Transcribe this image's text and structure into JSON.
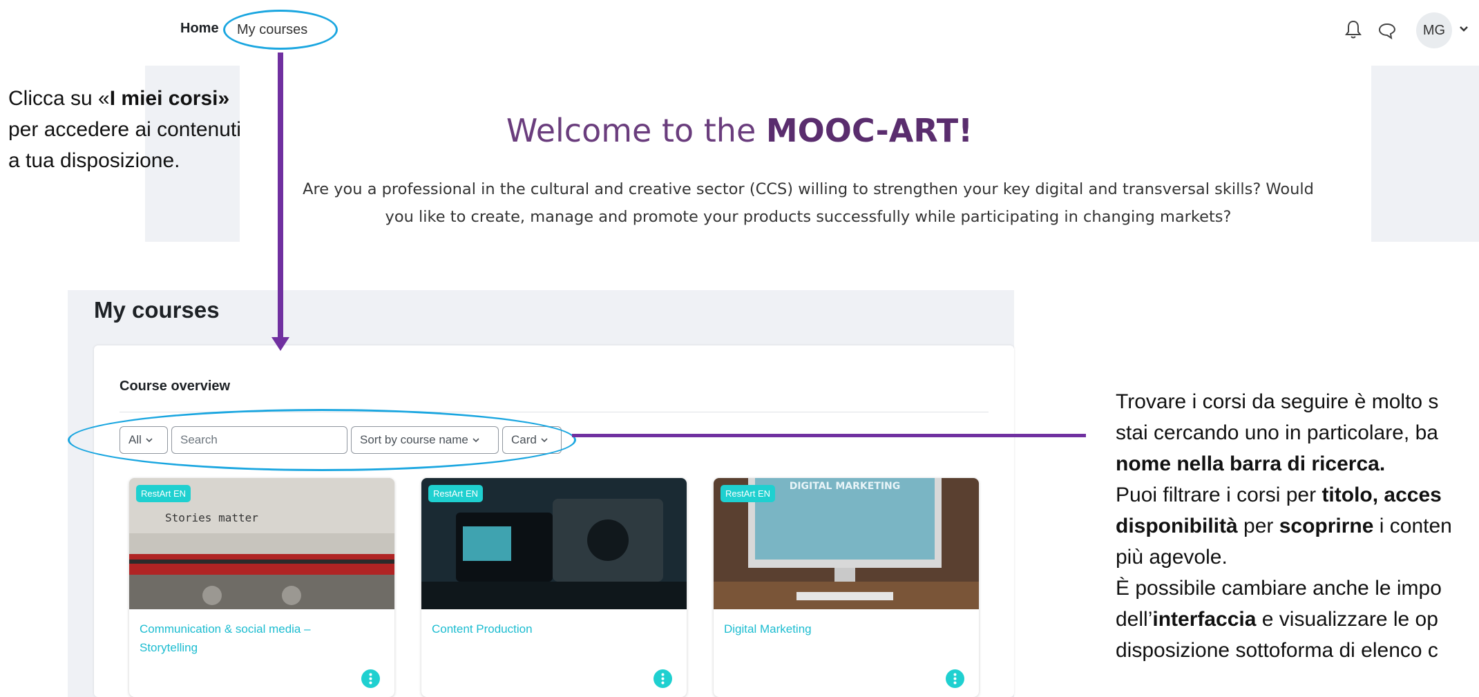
{
  "nav": {
    "home": "Home",
    "my_courses": "My courses",
    "avatar_initials": "MG",
    "icons": [
      "bell-icon",
      "chat-icon",
      "chevron-down-icon"
    ]
  },
  "banner": {
    "welcome_prefix": "Welcome to the ",
    "welcome_brand": "MOOC-ART!",
    "intro_line1": "Are you a professional in the cultural and creative sector (CCS) willing to strengthen your key digital and transversal skills? Would",
    "intro_line2": "you like to create, manage and promote your products successfully while participating in changing markets?"
  },
  "annotation_left": {
    "p1": "Clicca su «",
    "p1_bold": "I miei corsi»",
    "p2": " per accedere ai contenuti a tua disposizione."
  },
  "my_courses": {
    "title": "My courses",
    "overview_title": "Course overview",
    "filter_all": "All",
    "search_placeholder": "Search",
    "sort_label": "Sort by course name",
    "view_label": "Card",
    "courses": [
      {
        "badge": "RestArt EN",
        "name": "Communication & social media – Storytelling",
        "image_text": "Stories matter"
      },
      {
        "badge": "RestArt EN",
        "name": "Content Production",
        "image_text": ""
      },
      {
        "badge": "RestArt EN",
        "name": "Digital Marketing",
        "image_text": "DIGITAL MARKETING"
      }
    ]
  },
  "annotation_right": {
    "l1": "Trovare i corsi da seguire è molto s",
    "l2": "stai cercando uno in particolare, ba",
    "l3_bold": "nome nella barra di ricerca.",
    "l4_a": "Puoi filtrare i corsi per ",
    "l4_b": "titolo, acces",
    "l5_b": "disponibilità",
    "l5_a": " per ",
    "l5_c": "scoprirne",
    "l5_d": " i conten",
    "l6": "più agevole.",
    "l7": "È possibile cambiare anche le impo",
    "l8_a": "dell’",
    "l8_b": "interfaccia",
    "l8_c": " e visualizzare le op",
    "l9": "disposizione sottoforma di elenco c"
  },
  "colors": {
    "accent_purple": "#7030a0",
    "annotation_blue": "#1aa6e0",
    "course_teal": "#1fd0d0",
    "welcome_purple": "#6a3d7d"
  }
}
